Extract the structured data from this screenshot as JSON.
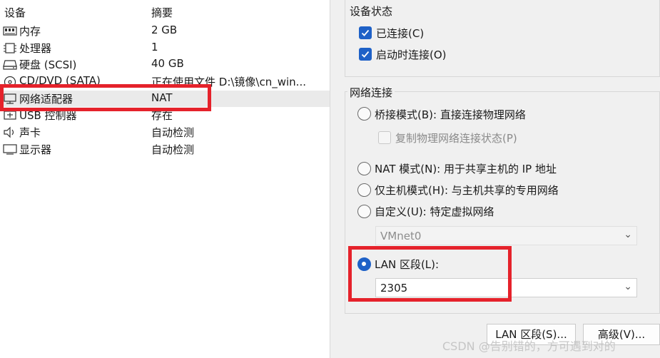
{
  "columns": {
    "device": "设备",
    "summary": "摘要"
  },
  "devices": [
    {
      "name": "内存",
      "summary": "2 GB",
      "icon": "memory-icon"
    },
    {
      "name": "处理器",
      "summary": "1",
      "icon": "processor-icon"
    },
    {
      "name": "硬盘 (SCSI)",
      "summary": "40 GB",
      "icon": "harddisk-icon"
    },
    {
      "name": "CD/DVD (SATA)",
      "summary": "正在使用文件 D:\\镜像\\cn_win...",
      "icon": "cd-dvd-icon"
    },
    {
      "name": "网络适配器",
      "summary": "NAT",
      "icon": "network-adapter-icon"
    },
    {
      "name": "USB 控制器",
      "summary": "存在",
      "icon": "usb-icon"
    },
    {
      "name": "声卡",
      "summary": "自动检测",
      "icon": "speaker-icon"
    },
    {
      "name": "显示器",
      "summary": "自动检测",
      "icon": "monitor-icon"
    }
  ],
  "device_status": {
    "title": "设备状态",
    "connected": {
      "label": "已连接(C)",
      "checked": true
    },
    "connect_on_start": {
      "label": "启动时连接(O)",
      "checked": true
    }
  },
  "network_connection": {
    "title": "网络连接",
    "bridged": {
      "label": "桥接模式(B): 直接连接物理网络",
      "checked": false
    },
    "replicate": {
      "label": "复制物理网络连接状态(P)",
      "checked": false
    },
    "nat": {
      "label": "NAT 模式(N): 用于共享主机的 IP 地址",
      "checked": false
    },
    "host_only": {
      "label": "仅主机模式(H): 与主机共享的专用网络",
      "checked": false
    },
    "custom": {
      "label": "自定义(U): 特定虚拟网络",
      "checked": false
    },
    "custom_select": "VMnet0",
    "lan_segment": {
      "label": "LAN 区段(L):",
      "checked": true
    },
    "lan_select": "2305"
  },
  "buttons": {
    "lan_segments": "LAN 区段(S)...",
    "advanced": "高级(V)..."
  },
  "watermark": "CSDN @告别错的，方可遇到对的",
  "colors": {
    "accent": "#1e61c7",
    "highlight": "#e5222b"
  }
}
